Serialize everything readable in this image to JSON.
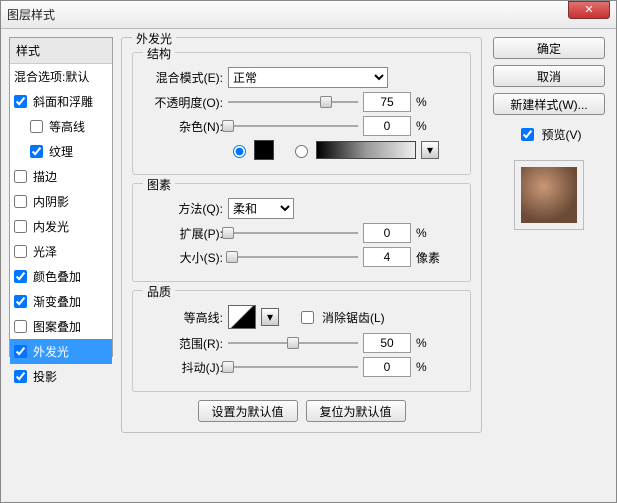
{
  "window": {
    "title": "图层样式"
  },
  "buttons": {
    "ok": "确定",
    "cancel": "取消",
    "newStyle": "新建样式(W)...",
    "setDefault": "设置为默认值",
    "resetDefault": "复位为默认值",
    "close": "✕"
  },
  "preview": {
    "label": "预览(V)",
    "checked": true
  },
  "leftPanel": {
    "header": "样式",
    "blendingOptions": "混合选项:默认",
    "items": [
      {
        "key": "bevel",
        "label": "斜面和浮雕",
        "checked": true,
        "indent": false
      },
      {
        "key": "contourSub",
        "label": "等高线",
        "checked": false,
        "indent": true
      },
      {
        "key": "texture",
        "label": "纹理",
        "checked": true,
        "indent": true
      },
      {
        "key": "stroke",
        "label": "描边",
        "checked": false,
        "indent": false
      },
      {
        "key": "innerShadow",
        "label": "内阴影",
        "checked": false,
        "indent": false
      },
      {
        "key": "innerGlow",
        "label": "内发光",
        "checked": false,
        "indent": false
      },
      {
        "key": "satin",
        "label": "光泽",
        "checked": false,
        "indent": false
      },
      {
        "key": "colorOverlay",
        "label": "颜色叠加",
        "checked": true,
        "indent": false
      },
      {
        "key": "gradOverlay",
        "label": "渐变叠加",
        "checked": true,
        "indent": false
      },
      {
        "key": "patternOverlay",
        "label": "图案叠加",
        "checked": false,
        "indent": false
      },
      {
        "key": "outerGlow",
        "label": "外发光",
        "checked": true,
        "indent": false,
        "selected": true
      },
      {
        "key": "dropShadow",
        "label": "投影",
        "checked": true,
        "indent": false
      }
    ]
  },
  "outerGlow": {
    "title": "外发光",
    "structure": {
      "title": "结构",
      "blendModeLabel": "混合模式(E):",
      "blendMode": "正常",
      "opacityLabel": "不透明度(O):",
      "opacity": 75,
      "opacityUnit": "%",
      "opacityPos": 75,
      "noiseLabel": "杂色(N):",
      "noise": 0,
      "noiseUnit": "%",
      "noisePos": 0,
      "colorMode": "solid"
    },
    "elements": {
      "title": "图素",
      "techniqueLabel": "方法(Q):",
      "technique": "柔和",
      "spreadLabel": "扩展(P):",
      "spread": 0,
      "spreadUnit": "%",
      "spreadPos": 0,
      "sizeLabel": "大小(S):",
      "size": 4,
      "sizeUnit": "像素",
      "sizePos": 3
    },
    "quality": {
      "title": "品质",
      "contourLabel": "等高线:",
      "antiAliasLabel": "消除锯齿(L)",
      "antiAlias": false,
      "rangeLabel": "范围(R):",
      "range": 50,
      "rangeUnit": "%",
      "rangePos": 50,
      "jitterLabel": "抖动(J):",
      "jitter": 0,
      "jitterUnit": "%",
      "jitterPos": 0
    }
  }
}
